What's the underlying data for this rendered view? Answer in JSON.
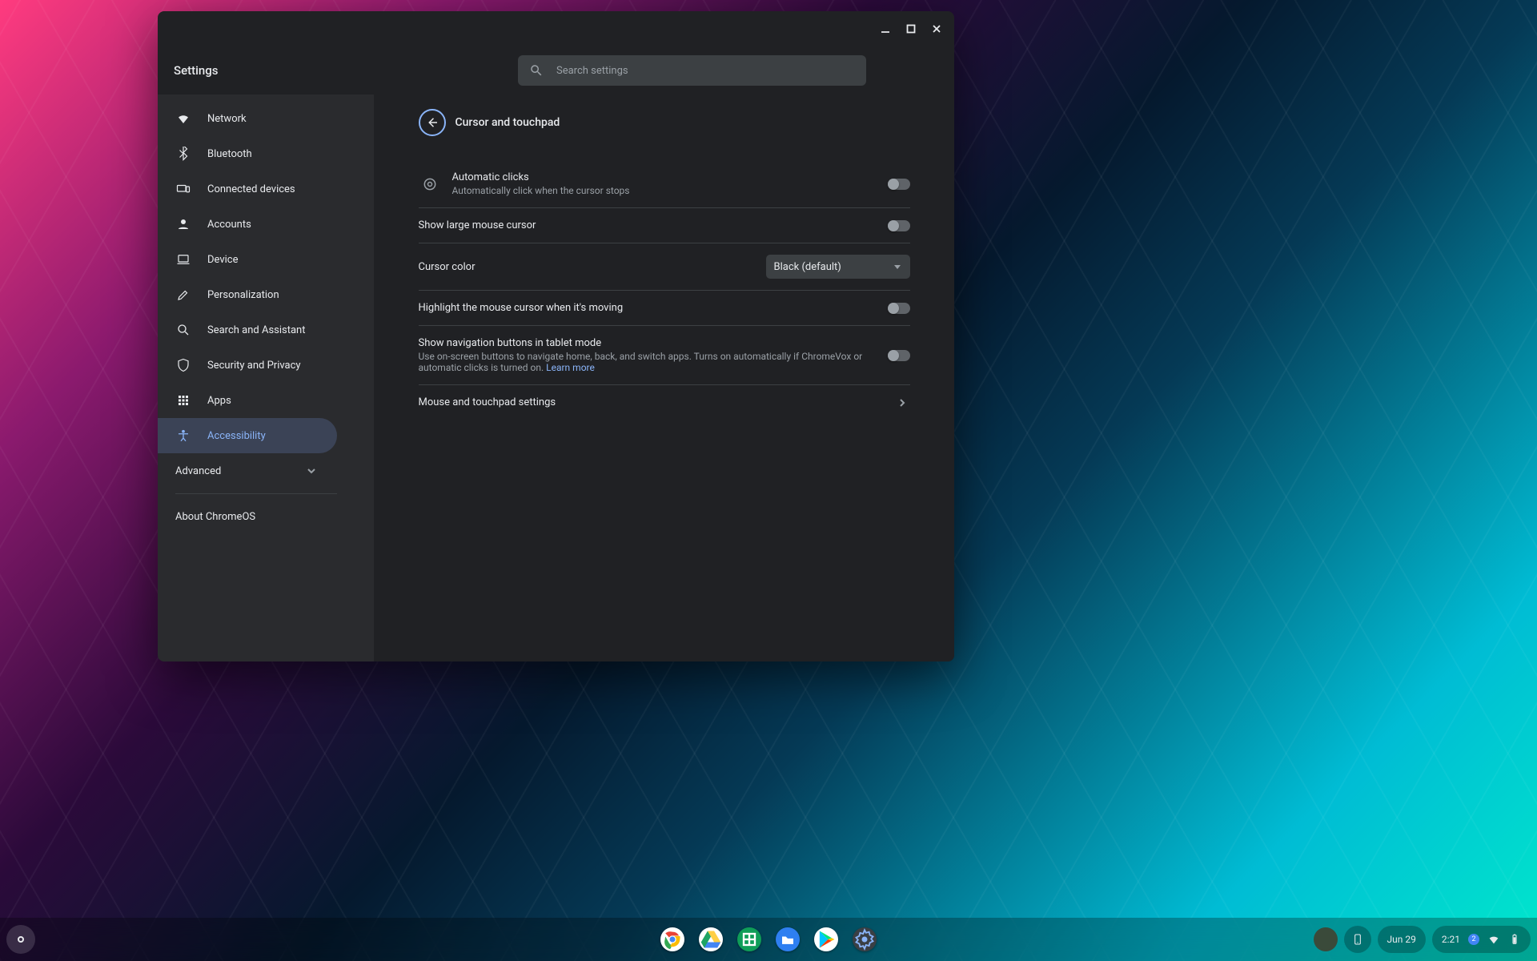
{
  "app": {
    "title": "Settings"
  },
  "search": {
    "placeholder": "Search settings"
  },
  "sidebar": {
    "items": [
      {
        "icon": "wifi",
        "label": "Network"
      },
      {
        "icon": "bluetooth",
        "label": "Bluetooth"
      },
      {
        "icon": "devices",
        "label": "Connected devices"
      },
      {
        "icon": "person",
        "label": "Accounts"
      },
      {
        "icon": "laptop",
        "label": "Device"
      },
      {
        "icon": "brush",
        "label": "Personalization"
      },
      {
        "icon": "search",
        "label": "Search and Assistant"
      },
      {
        "icon": "shield",
        "label": "Security and Privacy"
      },
      {
        "icon": "apps",
        "label": "Apps"
      },
      {
        "icon": "a11y",
        "label": "Accessibility"
      }
    ],
    "advanced_label": "Advanced",
    "about_label": "About ChromeOS"
  },
  "page": {
    "title": "Cursor and touchpad",
    "rows": {
      "auto_click": {
        "title": "Automatic clicks",
        "sub": "Automatically click when the cursor stops",
        "on": false
      },
      "large_cursor": {
        "title": "Show large mouse cursor",
        "on": false
      },
      "cursor_color": {
        "label": "Cursor color",
        "value": "Black (default)"
      },
      "highlight_cursor": {
        "title": "Highlight the mouse cursor when it's moving",
        "on": false
      },
      "nav_buttons": {
        "title": "Show navigation buttons in tablet mode",
        "sub": "Use on-screen buttons to navigate home, back, and switch apps. Turns on automatically if ChromeVox or automatic clicks is turned on. ",
        "learn_more": "Learn more",
        "on": false
      },
      "mouse_settings": {
        "title": "Mouse and touchpad settings"
      }
    }
  },
  "shelf": {
    "date": "Jun 29",
    "time": "2:21",
    "notif_count": "2",
    "apps": [
      "chrome",
      "drive",
      "sheets",
      "files",
      "play",
      "settings"
    ]
  }
}
